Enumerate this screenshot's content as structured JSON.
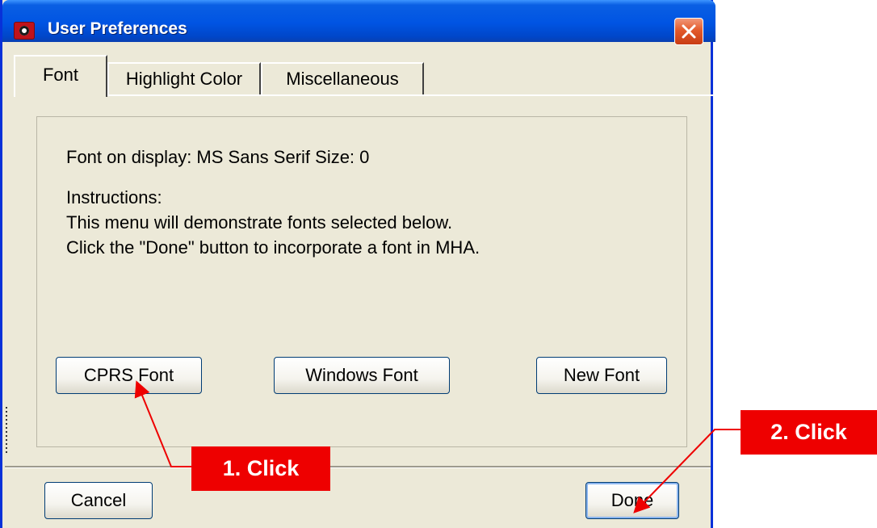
{
  "window": {
    "title": "User Preferences",
    "close_icon": "close-icon"
  },
  "tabs": [
    {
      "label": "Font",
      "active": true
    },
    {
      "label": "Highlight Color",
      "active": false
    },
    {
      "label": "Miscellaneous",
      "active": false
    }
  ],
  "font_panel": {
    "font_line": "Font on display: MS Sans Serif   Size: 0",
    "instructions_heading": "Instructions:",
    "instructions_line1": "This menu will demonstrate fonts selected below.",
    "instructions_line2": "Click the \"Done\" button to incorporate a font in MHA.",
    "buttons": {
      "cprs": "CPRS Font",
      "windows": "Windows Font",
      "new": "New Font"
    }
  },
  "footer": {
    "cancel": "Cancel",
    "done": "Done"
  },
  "annotations": {
    "step1": "1. Click",
    "step2": "2. Click",
    "color": "#ee0000"
  }
}
